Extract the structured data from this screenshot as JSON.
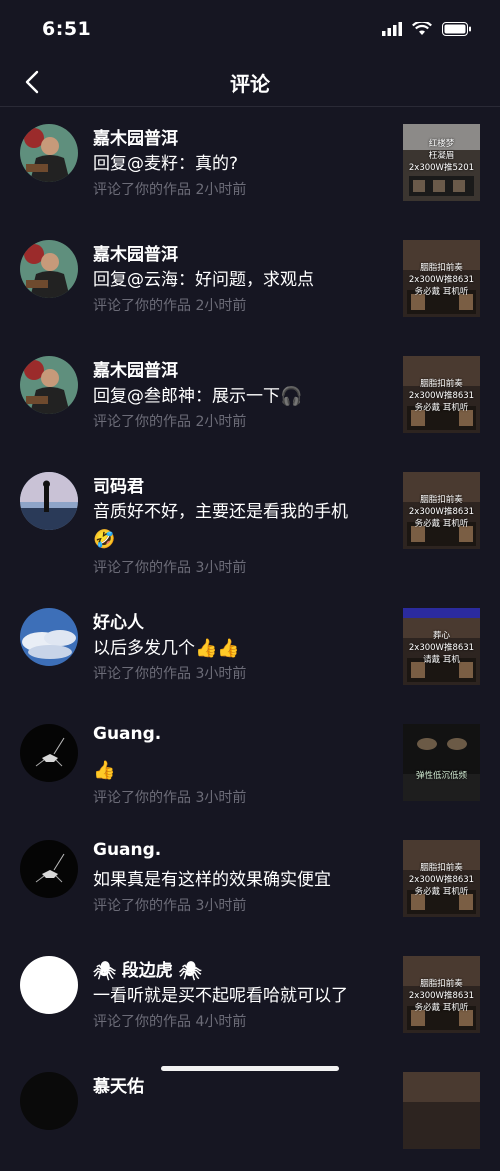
{
  "status": {
    "time": "6:51"
  },
  "nav": {
    "title": "评论",
    "back_icon": "chevron-left-icon"
  },
  "comments": [
    {
      "name": "嘉木园普洱",
      "text": "回复@麦籽：真的?",
      "meta": "评论了你的作品  2小时前",
      "emoji": "",
      "thumb": "红楼梦\n枉凝眉\n2x300W推5201"
    },
    {
      "name": "嘉木园普洱",
      "text": "回复@云海：好问题，求观点",
      "meta": "评论了你的作品  2小时前",
      "emoji": "",
      "thumb": "胭脂扣前奏\n2x300W推8631\n务必戴  耳机听"
    },
    {
      "name": "嘉木园普洱",
      "text": "回复@叁郎神：展示一下",
      "meta": "评论了你的作品  2小时前",
      "emoji": "🎧",
      "thumb": "胭脂扣前奏\n2x300W推8631\n务必戴  耳机听"
    },
    {
      "name": "司码君",
      "text": "音质好不好，主要还是看我的手机",
      "meta": "评论了你的作品  3小时前",
      "emoji": "🤣",
      "thumb": "胭脂扣前奏\n2x300W推8631\n务必戴  耳机听"
    },
    {
      "name": "好心人",
      "text": "以后多发几个",
      "meta": "评论了你的作品  3小时前",
      "emoji": "👍👍",
      "thumb": "葬心\n2x300W推8631\n请戴  耳机"
    },
    {
      "name": "Guang.",
      "text": "",
      "meta": "评论了你的作品  3小时前",
      "emoji": "👍",
      "thumb": "弹性低沉低频"
    },
    {
      "name": "Guang.",
      "text": "如果真是有这样的效果确实便宜",
      "meta": "评论了你的作品  3小时前",
      "emoji": "",
      "thumb": "胭脂扣前奏\n2x300W推8631\n务必戴  耳机听"
    },
    {
      "name": "段边虎",
      "text": "一看听就是买不起呢看哈就可以了",
      "meta": "评论了你的作品  4小时前",
      "emoji": "",
      "thumb": "胭脂扣前奏\n2x300W推8631\n务必戴  耳机听"
    },
    {
      "name": "慕天佑",
      "text": "",
      "meta": "",
      "emoji": "",
      "thumb": ""
    }
  ]
}
